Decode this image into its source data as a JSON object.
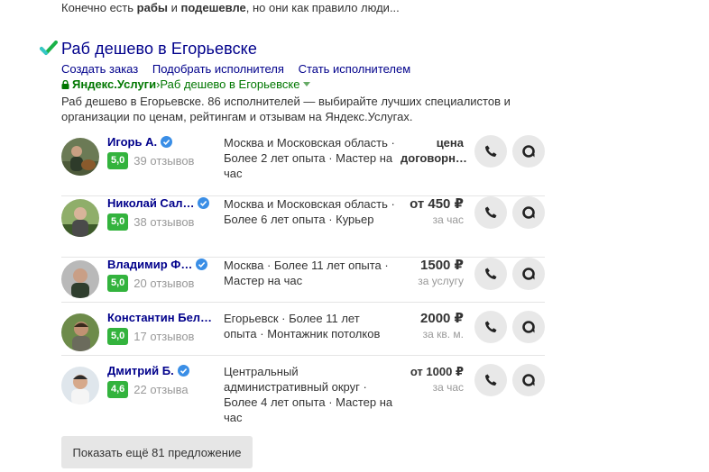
{
  "snippet": {
    "pre": "Конечно есть ",
    "b1": "рабы",
    "mid": " и ",
    "b2": "подешевле",
    "post": ", но они как правило люди..."
  },
  "result": {
    "title": "Раб дешево в Егорьевске",
    "sitelinks": [
      "Создать заказ",
      "Подобрать исполнителя",
      "Стать исполнителем"
    ],
    "site_name": "Яндекс.Услуги",
    "path_sep": " › ",
    "path_tail": "Раб дешево в Егорьевске",
    "description": "Раб дешево в Егорьевске. 86 исполнителей — выбирайте лучших специалистов и организации по ценам, рейтингам и отзывам на Яндекс.Услугах."
  },
  "workers": [
    {
      "name": "Игорь А.",
      "rating": "5,0",
      "reviews": "39 отзывов",
      "info": "Москва и Московская область · Более 2 лет опыта · Мастер на час",
      "price": "цена договорн…",
      "unit": ""
    },
    {
      "name": "Николай Сал…",
      "rating": "5,0",
      "reviews": "38 отзывов",
      "info": "Москва и Московская область · Более 6 лет опыта · Курьер",
      "price": "от 450 ₽",
      "unit": "за час"
    },
    {
      "name": "Владимир Ф…",
      "rating": "5,0",
      "reviews": "20 отзывов",
      "info": "Москва · Более 11 лет опыта · Мастер на час",
      "price": "1500 ₽",
      "unit": "за услугу"
    },
    {
      "name": "Константин Бел…",
      "rating": "5,0",
      "reviews": "17 отзывов",
      "info": "Егорьевск · Более 11 лет опыта · Монтажник потолков",
      "price": "2000 ₽",
      "unit": "за кв. м."
    },
    {
      "name": "Дмитрий Б.",
      "rating": "4,6",
      "reviews": "22 отзыва",
      "info": "Центральный административный округ · Более 4 лет опыта · Мастер на час",
      "price": "от 1000 ₽",
      "unit": "за час"
    }
  ],
  "more_button": "Показать ещё 81 предложение",
  "colors": {
    "link": "#00008b",
    "green": "#007700",
    "badge": "#33b33d",
    "button_bg": "#e8e8e8"
  },
  "icons": {
    "check": "green-check-icon",
    "verified": "verified-badge-icon",
    "call": "phone-icon",
    "chat": "chat-icon",
    "lock": "lock-icon"
  }
}
